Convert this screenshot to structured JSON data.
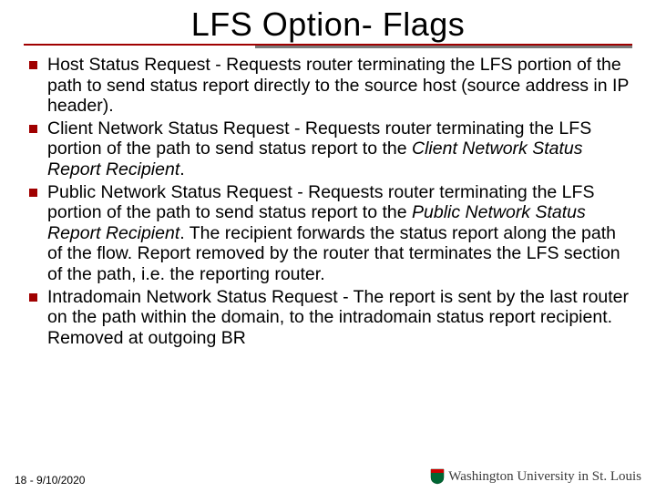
{
  "title": "LFS Option- Flags",
  "bullets": [
    {
      "term": "Host Status Request",
      "rest": " - Requests router terminating the LFS portion of the path to send status report directly to the source host (source address in IP header).",
      "italic_phrase": null
    },
    {
      "term": "Client Network Status Request",
      "rest_before": " - Requests router terminating the LFS portion of the path to send status report to the ",
      "italic_phrase": "Client Network Status Report Recipient",
      "rest_after": "."
    },
    {
      "term": "Public Network Status Request",
      "rest_before": " - Requests router terminating the LFS portion of the path to send status report to the ",
      "italic_phrase": "Public Network Status Report Recipient",
      "rest_after": ". The recipient forwards the status report along the path of the flow. Report removed by the router that terminates the LFS section of the path, i.e. the reporting router."
    },
    {
      "term": "Intradomain Network Status Request",
      "rest": " - The report is sent by the last router on the path within the domain, to the intradomain status report recipient. Removed at outgoing BR"
    }
  ],
  "footer": {
    "page": "18",
    "separator": " - ",
    "date": "9/10/2020"
  },
  "logo": {
    "name": "Washington University in St. Louis"
  },
  "colors": {
    "accent": "#a00000",
    "gray": "#7a7a7a"
  }
}
